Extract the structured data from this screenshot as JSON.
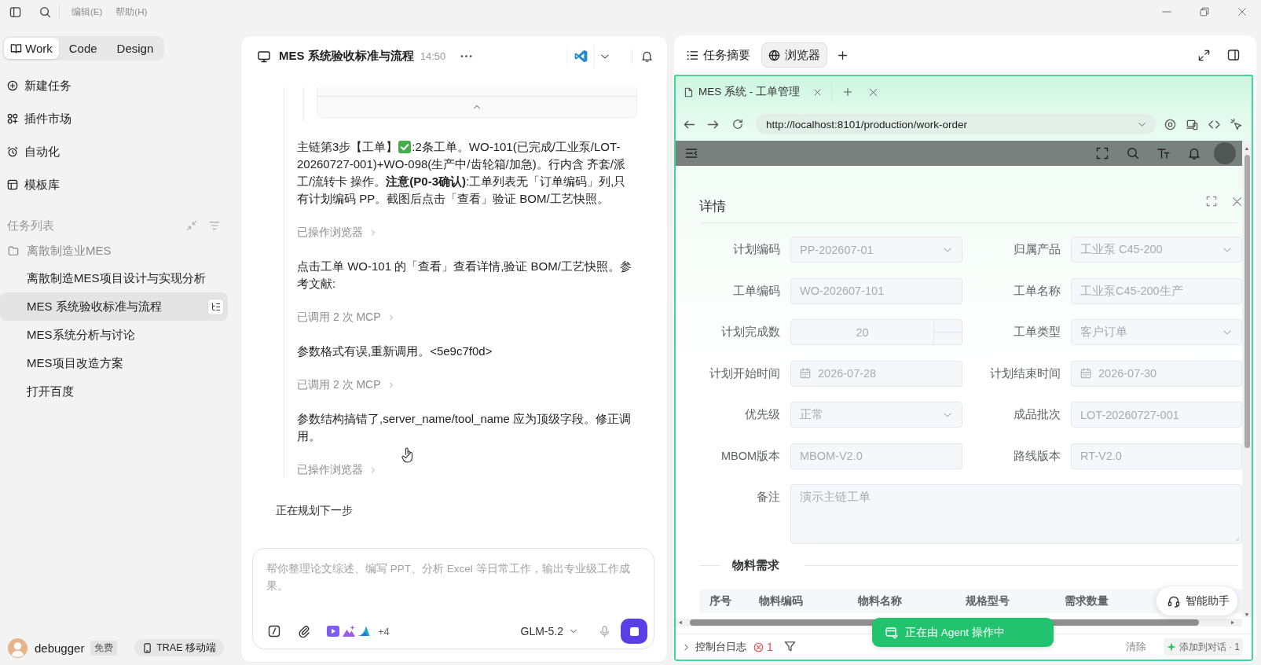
{
  "title_bar": {
    "menus": [
      "编辑(E)",
      "帮助(H)"
    ]
  },
  "sidebar": {
    "mode_tabs": [
      {
        "label": "Work",
        "selected": true
      },
      {
        "label": "Code",
        "selected": false
      },
      {
        "label": "Design",
        "selected": false
      }
    ],
    "nav_items": [
      {
        "label": "新建任务"
      },
      {
        "label": "插件市场"
      },
      {
        "label": "自动化"
      },
      {
        "label": "模板库"
      }
    ],
    "task_list": {
      "title": "任务列表",
      "groups": [
        {
          "label": "离散制造业MES",
          "children": [
            {
              "label": "离散制造MES项目设计与实现分析",
              "selected": false
            },
            {
              "label": "MES 系统验收标准与流程",
              "selected": true
            },
            {
              "label": "MES系统分析与讨论",
              "selected": false
            },
            {
              "label": "MES项目改造方案",
              "selected": false
            },
            {
              "label": "打开百度",
              "selected": false
            }
          ]
        }
      ]
    },
    "user": {
      "name": "debugger",
      "plan": "免费"
    },
    "mobile_button": "TRAE 移动端"
  },
  "chat": {
    "title": "MES 系统验收标准与流程",
    "time": "14:50",
    "messages": [
      {
        "kind": "text",
        "parts": [
          {
            "kind": "text",
            "text": "主链第3步【工单】"
          },
          {
            "kind": "check_icon"
          },
          {
            "kind": "text",
            "text": ":2条工单。WO-101(已完成/工业泵/LOT-20260727-001)+WO-098(生产中/齿轮箱/加急)。行内含 齐套/派工/流转卡 操作。**注意(P0-3确认)**:工单列表无「订单编码」列,只有计划编码 PP。截图后点击「查看」验证 BOM/工艺快照。"
          }
        ]
      },
      {
        "kind": "action",
        "text": "已操作浏览器"
      },
      {
        "kind": "text",
        "parts": [
          {
            "kind": "text",
            "text": "点击工单 WO-101 的「查看」查看详情,验证 BOM/工艺快照。参考文献:"
          }
        ]
      },
      {
        "kind": "action",
        "text": "已调用 2 次 MCP"
      },
      {
        "kind": "text",
        "parts": [
          {
            "kind": "text",
            "text": "参数格式有误,重新调用。<5e9c7f0d>"
          }
        ]
      },
      {
        "kind": "action",
        "text": "已调用 2 次 MCP"
      },
      {
        "kind": "text",
        "parts": [
          {
            "kind": "text",
            "text": "参数结构搞错了,server_name/tool_name 应为顶级字段。修正调用。"
          }
        ]
      },
      {
        "kind": "action",
        "text": "已操作浏览器"
      }
    ],
    "status": "正在规划下一步",
    "composer": {
      "placeholder": "帮你整理论文综述、编写 PPT、分析 Excel 等日常工作，输出专业级工作成果。",
      "more_tools": "+4",
      "model": "GLM-5.2"
    }
  },
  "browser": {
    "tabs": [
      {
        "label": "任务摘要",
        "selected": false
      },
      {
        "label": "浏览器",
        "selected": true
      }
    ],
    "page_tab": {
      "title": "MES 系统 - 工单管理"
    },
    "url": "http://localhost:8101/production/work-order",
    "dialog": {
      "title": "详情",
      "fields": [
        {
          "label": "计划编码",
          "kind": "select",
          "value": "PP-202607-01",
          "disabled": true
        },
        {
          "label": "归属产品",
          "kind": "select",
          "value": "工业泵 C45-200",
          "disabled": true
        },
        {
          "label": "工单编码",
          "kind": "text",
          "value": "WO-202607-101",
          "disabled": true
        },
        {
          "label": "工单名称",
          "kind": "text",
          "value": "工业泵C45-200生产",
          "disabled": true
        },
        {
          "label": "计划完成数",
          "kind": "number",
          "value": "20",
          "disabled": true
        },
        {
          "label": "工单类型",
          "kind": "select",
          "value": "客户订单",
          "disabled": true
        },
        {
          "label": "计划开始时间",
          "kind": "date",
          "value": "2026-07-28",
          "disabled": true
        },
        {
          "label": "计划结束时间",
          "kind": "date",
          "value": "2026-07-30",
          "disabled": true
        },
        {
          "label": "优先级",
          "kind": "select",
          "value": "正常",
          "disabled": true
        },
        {
          "label": "成品批次",
          "kind": "text",
          "value": "LOT-20260727-001",
          "disabled": true
        },
        {
          "label": "MBOM版本",
          "kind": "text",
          "value": "MBOM-V2.0",
          "disabled": true
        },
        {
          "label": "路线版本",
          "kind": "text",
          "value": "RT-V2.0",
          "disabled": true
        },
        {
          "label": "备注",
          "kind": "textarea",
          "value": "演示主链工单",
          "disabled": true
        }
      ],
      "section_title": "物料需求",
      "table": {
        "columns": [
          "序号",
          "物料编码",
          "物料名称",
          "规格型号",
          "需求数量"
        ]
      }
    },
    "agent_badge": "正在由 Agent 操作中",
    "assistant_button": "智能助手",
    "console": {
      "title": "控制台日志",
      "error_count": "1",
      "clear_button": "清除",
      "add_button": "添加到对话 · 1"
    }
  }
}
